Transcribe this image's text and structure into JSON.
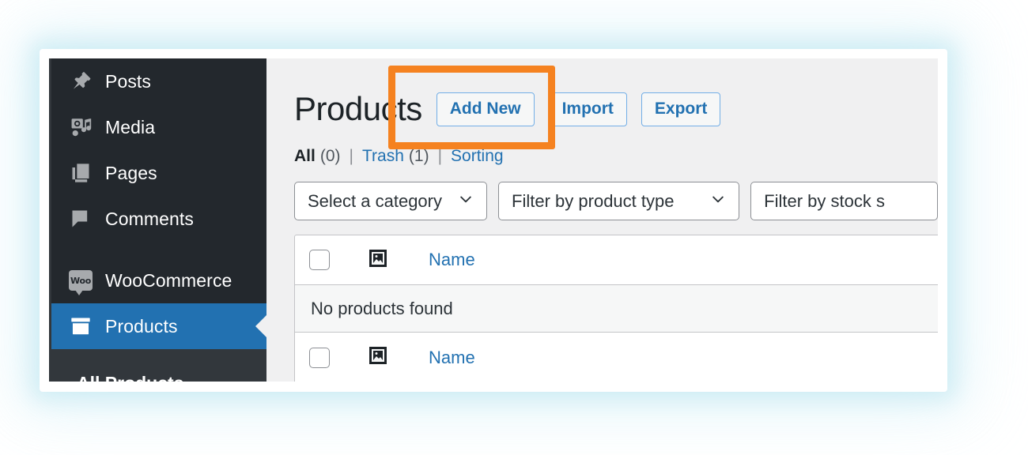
{
  "sidebar": {
    "items": [
      {
        "label": "Posts",
        "icon": "pin-icon",
        "current": false
      },
      {
        "label": "Media",
        "icon": "media-icon",
        "current": false
      },
      {
        "label": "Pages",
        "icon": "pages-icon",
        "current": false
      },
      {
        "label": "Comments",
        "icon": "comment-icon",
        "current": false
      },
      {
        "label": "WooCommerce",
        "icon": "woocommerce-icon",
        "current": false
      },
      {
        "label": "Products",
        "icon": "products-box-icon",
        "current": true
      }
    ],
    "submenu": {
      "label": "All Products"
    },
    "colors": {
      "background": "#23282d",
      "current_background": "#2271b1",
      "submenu_background": "#32373c"
    }
  },
  "header": {
    "title": "Products",
    "buttons": [
      {
        "label": "Add New",
        "name": "add-new-button"
      },
      {
        "label": "Import",
        "name": "import-button"
      },
      {
        "label": "Export",
        "name": "export-button"
      }
    ],
    "colors": {
      "button_text": "#2271b1",
      "button_border": "#72aee6"
    }
  },
  "views": {
    "all_label": "All",
    "all_count": "(0)",
    "sep1": "|",
    "trash_label": "Trash",
    "trash_count": "(1)",
    "sep2": "|",
    "sorting_label": "Sorting"
  },
  "filters": [
    {
      "label": "Select a category",
      "name": "category-select",
      "icon": "chevron-down-icon"
    },
    {
      "label": "Filter by product type",
      "name": "product-type-select",
      "icon": "chevron-down-icon"
    },
    {
      "label": "Filter by stock s",
      "name": "stock-status-select",
      "icon": "chevron-down-icon"
    }
  ],
  "table": {
    "header": {
      "image_icon": "image-placeholder-icon",
      "name_label": "Name"
    },
    "empty_message": "No products found",
    "footer": {
      "image_icon": "image-placeholder-icon",
      "name_label": "Name"
    }
  },
  "annotation": {
    "highlight_color": "#f58220",
    "target": "Add New"
  }
}
